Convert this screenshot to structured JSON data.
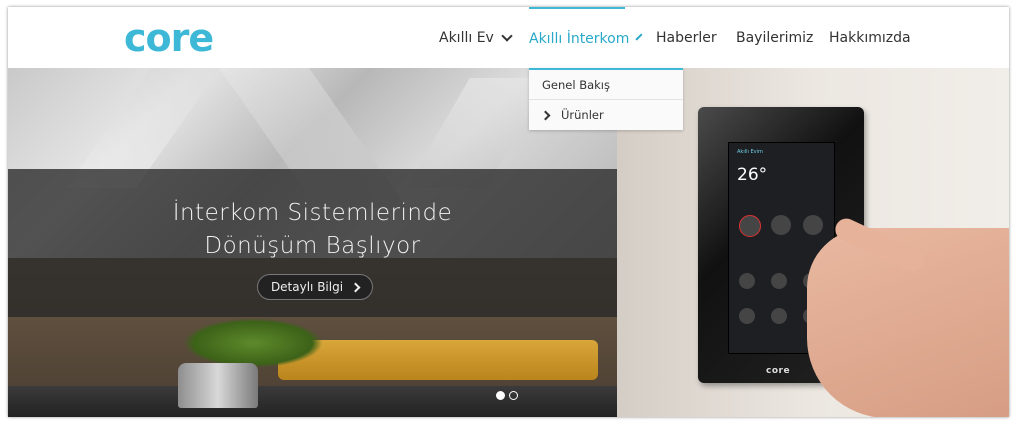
{
  "brand": {
    "logo_text": "core",
    "accent_color": "#3db8d6"
  },
  "nav": {
    "items": [
      {
        "label": "Akıllı Ev",
        "has_dropdown": true
      },
      {
        "label": "Akıllı İnterkom",
        "has_dropdown": true,
        "active": true
      },
      {
        "label": "Haberler"
      },
      {
        "label": "Bayilerimiz"
      },
      {
        "label": "Hakkımızda"
      }
    ]
  },
  "dropdown": {
    "items": [
      {
        "label": "Genel Bakış"
      },
      {
        "label": "Ürünler",
        "icon": "chevron-right-icon"
      }
    ]
  },
  "hero": {
    "headline_line1": "İnterkom Sistemlerinde",
    "headline_line2": "Dönüşüm Başlıyor",
    "cta_label": "Detaylı Bilgi",
    "slides": 2,
    "active_slide": 1
  },
  "device": {
    "screen_title": "Akıllı Evim",
    "temperature": "26°",
    "logo": "core"
  }
}
